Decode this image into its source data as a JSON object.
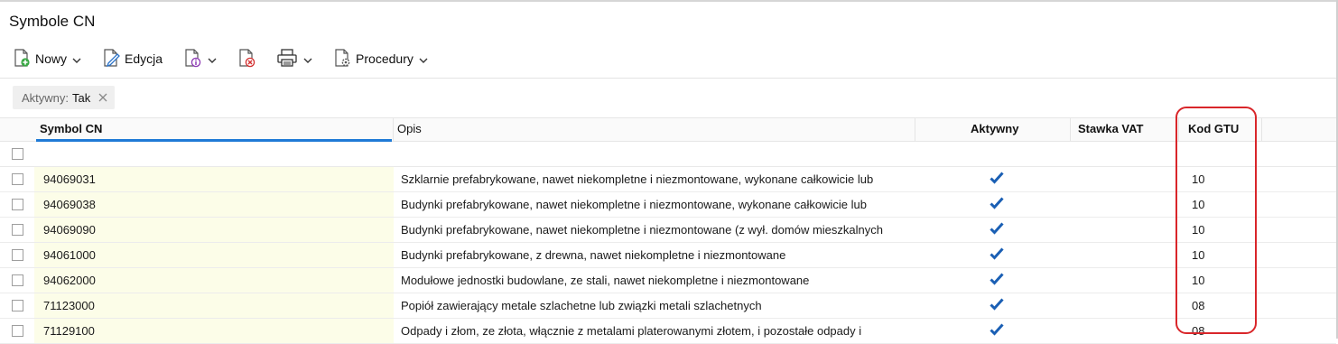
{
  "window": {
    "title": "Symbole CN"
  },
  "toolbar": {
    "new_label": "Nowy",
    "edit_label": "Edycja",
    "procedures_label": "Procedury"
  },
  "filter_chip": {
    "key": "Aktywny:",
    "value": "Tak"
  },
  "columns": {
    "symbol": "Symbol CN",
    "description": "Opis",
    "active": "Aktywny",
    "vat": "Stawka VAT",
    "gtu": "Kod GTU"
  },
  "rows": [
    {
      "symbol": "94069031",
      "description": "Szklarnie prefabrykowane, nawet niekompletne i niezmontowane, wykonane całkowicie lub",
      "active": true,
      "vat": "",
      "gtu": "10"
    },
    {
      "symbol": "94069038",
      "description": "Budynki prefabrykowane, nawet niekompletne i niezmontowane, wykonane całkowicie lub",
      "active": true,
      "vat": "",
      "gtu": "10"
    },
    {
      "symbol": "94069090",
      "description": "Budynki prefabrykowane, nawet niekompletne i niezmontowane (z wył. domów mieszkalnych",
      "active": true,
      "vat": "",
      "gtu": "10"
    },
    {
      "symbol": "94061000",
      "description": "Budynki prefabrykowane, z drewna, nawet niekompletne i niezmontowane",
      "active": true,
      "vat": "",
      "gtu": "10"
    },
    {
      "symbol": "94062000",
      "description": "Modułowe jednostki budowlane, ze stali, nawet niekompletne i niezmontowane",
      "active": true,
      "vat": "",
      "gtu": "10"
    },
    {
      "symbol": "71123000",
      "description": "Popiół zawierający metale szlachetne lub związki metali szlachetnych",
      "active": true,
      "vat": "",
      "gtu": "08"
    },
    {
      "symbol": "71129100",
      "description": "Odpady i złom, ze złota, włącznie z metalami platerowanymi złotem, i pozostałe odpady i",
      "active": true,
      "vat": "",
      "gtu": "08"
    }
  ],
  "colors": {
    "accent": "#1f7ad6",
    "highlight": "#d9262a",
    "symbol_bg": "#fcfde8"
  }
}
